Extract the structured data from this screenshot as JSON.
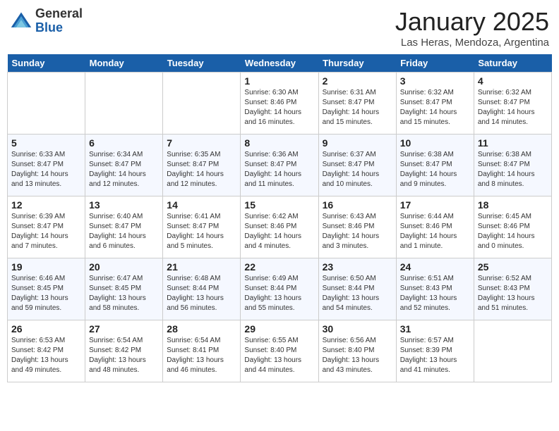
{
  "logo": {
    "general": "General",
    "blue": "Blue"
  },
  "title": "January 2025",
  "location": "Las Heras, Mendoza, Argentina",
  "days_of_week": [
    "Sunday",
    "Monday",
    "Tuesday",
    "Wednesday",
    "Thursday",
    "Friday",
    "Saturday"
  ],
  "weeks": [
    [
      {
        "day": "",
        "info": ""
      },
      {
        "day": "",
        "info": ""
      },
      {
        "day": "",
        "info": ""
      },
      {
        "day": "1",
        "info": "Sunrise: 6:30 AM\nSunset: 8:46 PM\nDaylight: 14 hours and 16 minutes."
      },
      {
        "day": "2",
        "info": "Sunrise: 6:31 AM\nSunset: 8:47 PM\nDaylight: 14 hours and 15 minutes."
      },
      {
        "day": "3",
        "info": "Sunrise: 6:32 AM\nSunset: 8:47 PM\nDaylight: 14 hours and 15 minutes."
      },
      {
        "day": "4",
        "info": "Sunrise: 6:32 AM\nSunset: 8:47 PM\nDaylight: 14 hours and 14 minutes."
      }
    ],
    [
      {
        "day": "5",
        "info": "Sunrise: 6:33 AM\nSunset: 8:47 PM\nDaylight: 14 hours and 13 minutes."
      },
      {
        "day": "6",
        "info": "Sunrise: 6:34 AM\nSunset: 8:47 PM\nDaylight: 14 hours and 12 minutes."
      },
      {
        "day": "7",
        "info": "Sunrise: 6:35 AM\nSunset: 8:47 PM\nDaylight: 14 hours and 12 minutes."
      },
      {
        "day": "8",
        "info": "Sunrise: 6:36 AM\nSunset: 8:47 PM\nDaylight: 14 hours and 11 minutes."
      },
      {
        "day": "9",
        "info": "Sunrise: 6:37 AM\nSunset: 8:47 PM\nDaylight: 14 hours and 10 minutes."
      },
      {
        "day": "10",
        "info": "Sunrise: 6:38 AM\nSunset: 8:47 PM\nDaylight: 14 hours and 9 minutes."
      },
      {
        "day": "11",
        "info": "Sunrise: 6:38 AM\nSunset: 8:47 PM\nDaylight: 14 hours and 8 minutes."
      }
    ],
    [
      {
        "day": "12",
        "info": "Sunrise: 6:39 AM\nSunset: 8:47 PM\nDaylight: 14 hours and 7 minutes."
      },
      {
        "day": "13",
        "info": "Sunrise: 6:40 AM\nSunset: 8:47 PM\nDaylight: 14 hours and 6 minutes."
      },
      {
        "day": "14",
        "info": "Sunrise: 6:41 AM\nSunset: 8:47 PM\nDaylight: 14 hours and 5 minutes."
      },
      {
        "day": "15",
        "info": "Sunrise: 6:42 AM\nSunset: 8:46 PM\nDaylight: 14 hours and 4 minutes."
      },
      {
        "day": "16",
        "info": "Sunrise: 6:43 AM\nSunset: 8:46 PM\nDaylight: 14 hours and 3 minutes."
      },
      {
        "day": "17",
        "info": "Sunrise: 6:44 AM\nSunset: 8:46 PM\nDaylight: 14 hours and 1 minute."
      },
      {
        "day": "18",
        "info": "Sunrise: 6:45 AM\nSunset: 8:46 PM\nDaylight: 14 hours and 0 minutes."
      }
    ],
    [
      {
        "day": "19",
        "info": "Sunrise: 6:46 AM\nSunset: 8:45 PM\nDaylight: 13 hours and 59 minutes."
      },
      {
        "day": "20",
        "info": "Sunrise: 6:47 AM\nSunset: 8:45 PM\nDaylight: 13 hours and 58 minutes."
      },
      {
        "day": "21",
        "info": "Sunrise: 6:48 AM\nSunset: 8:44 PM\nDaylight: 13 hours and 56 minutes."
      },
      {
        "day": "22",
        "info": "Sunrise: 6:49 AM\nSunset: 8:44 PM\nDaylight: 13 hours and 55 minutes."
      },
      {
        "day": "23",
        "info": "Sunrise: 6:50 AM\nSunset: 8:44 PM\nDaylight: 13 hours and 54 minutes."
      },
      {
        "day": "24",
        "info": "Sunrise: 6:51 AM\nSunset: 8:43 PM\nDaylight: 13 hours and 52 minutes."
      },
      {
        "day": "25",
        "info": "Sunrise: 6:52 AM\nSunset: 8:43 PM\nDaylight: 13 hours and 51 minutes."
      }
    ],
    [
      {
        "day": "26",
        "info": "Sunrise: 6:53 AM\nSunset: 8:42 PM\nDaylight: 13 hours and 49 minutes."
      },
      {
        "day": "27",
        "info": "Sunrise: 6:54 AM\nSunset: 8:42 PM\nDaylight: 13 hours and 48 minutes."
      },
      {
        "day": "28",
        "info": "Sunrise: 6:54 AM\nSunset: 8:41 PM\nDaylight: 13 hours and 46 minutes."
      },
      {
        "day": "29",
        "info": "Sunrise: 6:55 AM\nSunset: 8:40 PM\nDaylight: 13 hours and 44 minutes."
      },
      {
        "day": "30",
        "info": "Sunrise: 6:56 AM\nSunset: 8:40 PM\nDaylight: 13 hours and 43 minutes."
      },
      {
        "day": "31",
        "info": "Sunrise: 6:57 AM\nSunset: 8:39 PM\nDaylight: 13 hours and 41 minutes."
      },
      {
        "day": "",
        "info": ""
      }
    ]
  ]
}
